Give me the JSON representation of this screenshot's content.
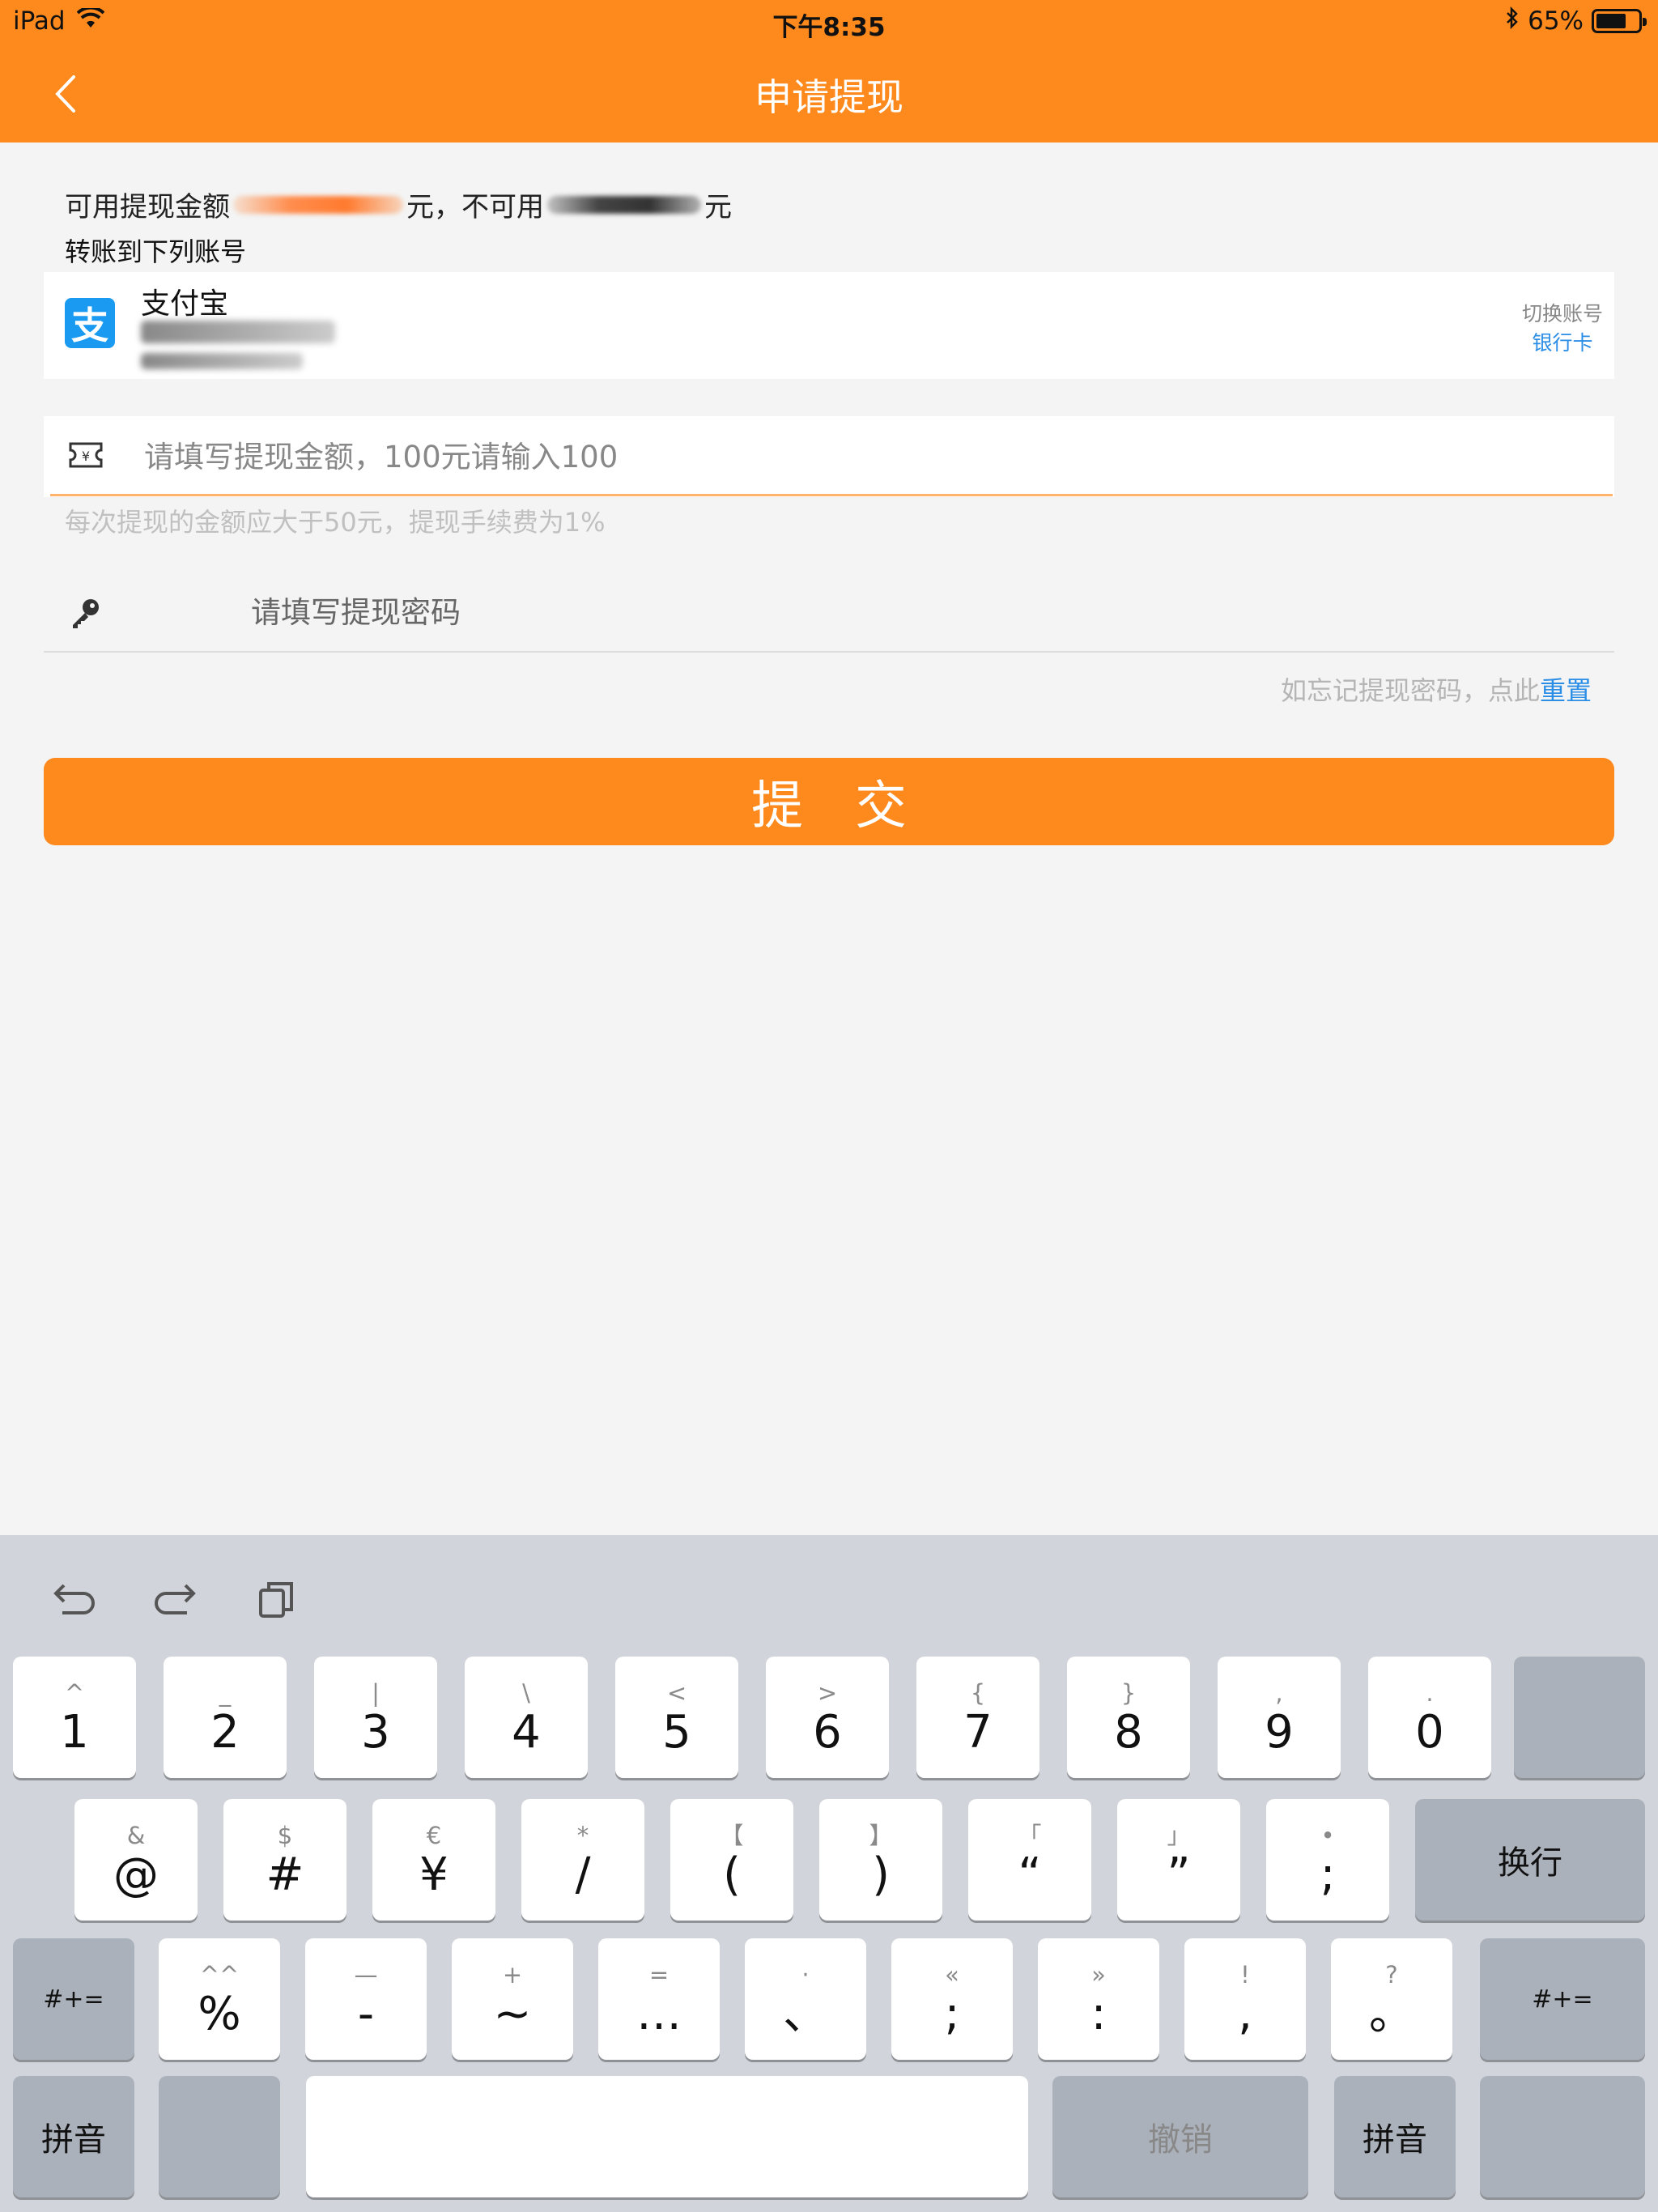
{
  "status_bar": {
    "device": "iPad",
    "time": "下午8:35",
    "battery": "65%"
  },
  "nav": {
    "title": "申请提现"
  },
  "balance": {
    "prefix": "可用提现金额",
    "unit1": "元，不可用",
    "unit2": "元"
  },
  "transfer_label": "转账到下列账号",
  "account": {
    "icon_char": "支",
    "name": "支付宝",
    "switch_label": "切换账号",
    "bank_card_label": "银行卡"
  },
  "amount": {
    "placeholder": "请填写提现金额，100元请输入100",
    "hint": "每次提现的金额应大于50元，提现手续费为1%"
  },
  "password": {
    "placeholder": "请填写提现密码",
    "forgot_text": "如忘记提现密码，点此",
    "reset_label": "重置"
  },
  "submit_label": "提交",
  "keyboard": {
    "row1": [
      {
        "sub": "^",
        "main": "1"
      },
      {
        "sub": "_",
        "main": "2"
      },
      {
        "sub": "|",
        "main": "3"
      },
      {
        "sub": "\\",
        "main": "4"
      },
      {
        "sub": "<",
        "main": "5"
      },
      {
        "sub": ">",
        "main": "6"
      },
      {
        "sub": "{",
        "main": "7"
      },
      {
        "sub": "}",
        "main": "8"
      },
      {
        "sub": ",",
        "main": "9"
      },
      {
        "sub": ".",
        "main": "0"
      }
    ],
    "row2": [
      {
        "sub": "&",
        "main": "@"
      },
      {
        "sub": "$",
        "main": "#"
      },
      {
        "sub": "€",
        "main": "¥"
      },
      {
        "sub": "*",
        "main": "/"
      },
      {
        "sub": "【",
        "main": "("
      },
      {
        "sub": "】",
        "main": ")"
      },
      {
        "sub": "「",
        "main": "“"
      },
      {
        "sub": "」",
        "main": "”"
      },
      {
        "sub": "•",
        "main": ";"
      }
    ],
    "return_label": "换行",
    "row3": [
      {
        "sub": "^^",
        "main": "%"
      },
      {
        "sub": "—",
        "main": "-"
      },
      {
        "sub": "+",
        "main": "~"
      },
      {
        "sub": "=",
        "main": "…"
      },
      {
        "sub": "·",
        "main": "、"
      },
      {
        "sub": "«",
        "main": ";"
      },
      {
        "sub": "»",
        "main": ":"
      },
      {
        "sub": "!",
        "main": ","
      },
      {
        "sub": "?",
        "main": "。"
      }
    ],
    "symbols_label": "#+=",
    "pinyin_label": "拼音",
    "undo_label": "撤销"
  }
}
